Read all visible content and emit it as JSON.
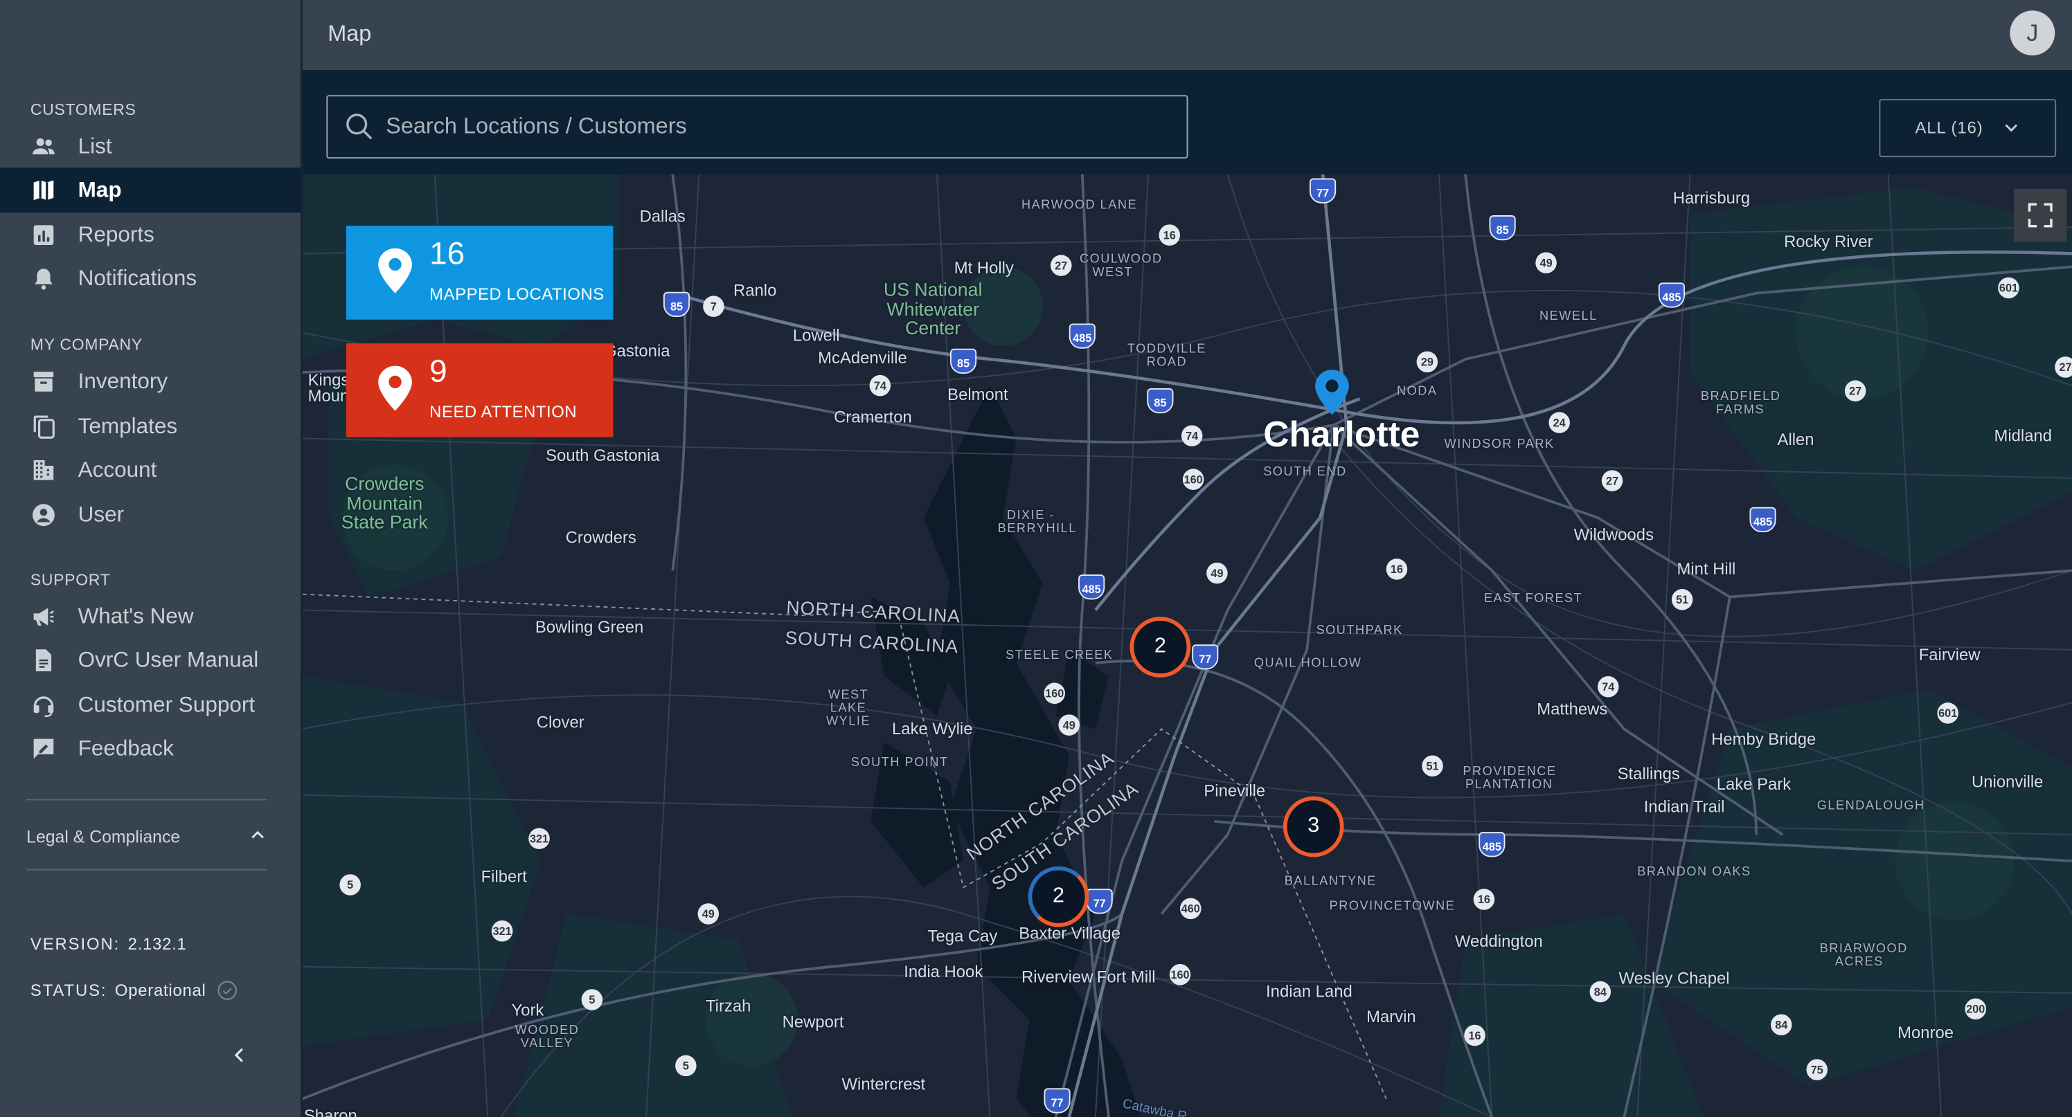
{
  "sidebar": {
    "customers_title": "CUSTOMERS",
    "company_title": "MY COMPANY",
    "support_title": "SUPPORT",
    "items": [
      {
        "label": "List",
        "icon": "people-icon"
      },
      {
        "label": "Map",
        "icon": "map-icon",
        "active": true
      },
      {
        "label": "Reports",
        "icon": "bar-chart-icon"
      },
      {
        "label": "Notifications",
        "icon": "bell-icon"
      },
      {
        "label": "Inventory",
        "icon": "inventory-icon"
      },
      {
        "label": "Templates",
        "icon": "copy-icon"
      },
      {
        "label": "Account",
        "icon": "building-icon"
      },
      {
        "label": "User",
        "icon": "user-circle-icon"
      },
      {
        "label": "What's New",
        "icon": "megaphone-icon"
      },
      {
        "label": "OvrC User Manual",
        "icon": "document-icon"
      },
      {
        "label": "Customer Support",
        "icon": "headset-icon"
      },
      {
        "label": "Feedback",
        "icon": "feedback-icon"
      }
    ],
    "legal": "Legal & Compliance",
    "version_label": "VERSION:",
    "version_value": "2.132.1",
    "status_label": "STATUS:",
    "status_value": "Operational"
  },
  "header": {
    "title": "Map",
    "avatar_initial": "J"
  },
  "search": {
    "placeholder": "Search Locations / Customers",
    "filter_label": "ALL (16)"
  },
  "summary": {
    "mapped_count": "16",
    "mapped_label": "MAPPED LOCATIONS",
    "attention_count": "9",
    "attention_label": "NEED ATTENTION"
  },
  "clusters": [
    "2",
    "3",
    "2"
  ],
  "colors": {
    "sidebar_bg": "#37434f",
    "active_bg": "#0c2234",
    "mapped_blue": "#0e97e0",
    "attention_red": "#d6321a",
    "cluster_orange": "#f15a2a"
  },
  "map_labels": {
    "charlotte": "Charlotte",
    "south_end": "SOUTH END",
    "noda": "NODA",
    "windsor_park": "WINDSOR PARK",
    "harrisburg": "Harrisburg",
    "rocky_river": "Rocky River",
    "newell": "NEWELL",
    "bradfield_farms": "BRADFIELD FARMS",
    "allen": "Allen",
    "midland": "Midland",
    "wildwoods": "Wildwoods",
    "mint_hill": "Mint Hill",
    "east_forest": "EAST FOREST",
    "fairview": "Fairview",
    "matthews": "Matthews",
    "hemby_bridge": "Hemby Bridge",
    "stallings": "Stallings",
    "indian_trail": "Indian Trail",
    "lake_park": "Lake Park",
    "unionville": "Unionville",
    "glendalough": "GLENDALOUGH",
    "brandon_oaks": "BRANDON OAKS",
    "weddington": "Weddington",
    "wesley_chapel": "Wesley Chapel",
    "briarwood_acres": "BRIARWOOD ACRES",
    "monroe": "Monroe",
    "marvin": "Marvin",
    "indian_land": "Indian Land",
    "provincetowne": "PROVINCETOWNE",
    "ballantyne": "BALLANTYNE",
    "pineville": "Pineville",
    "providence_plantation": "PROVIDENCE PLANTATION",
    "southpark": "SOUTHPARK",
    "quail_hollow": "QUAIL HOLLOW",
    "steele_creek": "STEELE CREEK",
    "dixie_berryhill": "DIXIE - BERRYHILL",
    "toddville_road": "TODDVILLE ROAD",
    "coulwood_west": "COULWOOD WEST",
    "harwood_lane": "HARWOOD LANE",
    "mt_holly": "Mt Holly",
    "whitewater": "US National Whitewater Center",
    "dallas": "Dallas",
    "ranlo": "Ranlo",
    "lowell": "Lowell",
    "mcadenville": "McAdenville",
    "gastonia": "Gastonia",
    "belmont": "Belmont",
    "cramerton": "Cramerton",
    "south_gastonia": "South Gastonia",
    "crowders_park": "Crowders Mountain State Park",
    "crowders": "Crowders",
    "kings_mountain": "Kings Mountain",
    "bowling_green": "Bowling Green",
    "clover": "Clover",
    "filbert": "Filbert",
    "york": "York",
    "wooded_valley": "WOODED VALLEY",
    "tirzah": "Tirzah",
    "newport": "Newport",
    "wintercrest": "Wintercrest",
    "lake_wylie": "Lake Wylie",
    "west_lake_wylie": "WEST LAKE WYLIE",
    "south_point": "SOUTH POINT",
    "tega_cay": "Tega Cay",
    "india_hook": "India Hook",
    "baxter_village": "Baxter Village",
    "riverview": "Riverview",
    "fort_mill": "Fort Mill",
    "nc": "NORTH CAROLINA",
    "sc": "SOUTH CAROLINA",
    "sharon": "Sharon",
    "catawba": "Catawba R."
  }
}
